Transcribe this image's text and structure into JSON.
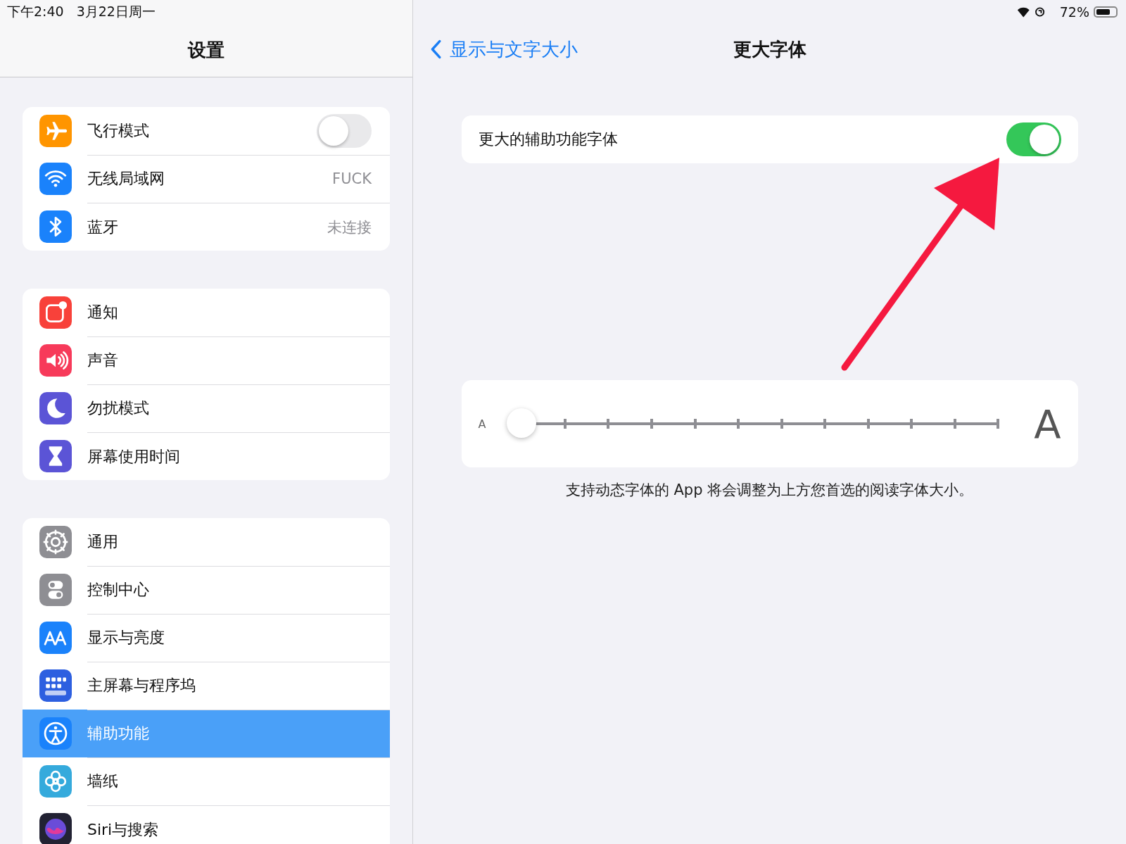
{
  "status_bar": {
    "time": "下午2:40",
    "date": "3月22日周一",
    "battery": "72%"
  },
  "sidebar": {
    "title": "设置",
    "groups": [
      [
        {
          "label": "飞行模式",
          "color": "#ff9500",
          "kind": "toggle",
          "on": false,
          "selected": false
        },
        {
          "label": "无线局域网",
          "color": "#1a82fb",
          "kind": "value",
          "value": "FUCK",
          "selected": false
        },
        {
          "label": "蓝牙",
          "color": "#1a82fb",
          "kind": "value",
          "value": "未连接",
          "selected": false
        }
      ],
      [
        {
          "label": "通知",
          "color": "#f8413a",
          "kind": "plain",
          "selected": false
        },
        {
          "label": "声音",
          "color": "#f73a5a",
          "kind": "plain",
          "selected": false
        },
        {
          "label": "勿扰模式",
          "color": "#5b54d6",
          "kind": "plain",
          "selected": false
        },
        {
          "label": "屏幕使用时间",
          "color": "#5b54d6",
          "kind": "plain",
          "selected": false
        }
      ],
      [
        {
          "label": "通用",
          "color": "#8e8e93",
          "kind": "plain",
          "selected": false
        },
        {
          "label": "控制中心",
          "color": "#8e8e93",
          "kind": "plain",
          "selected": false
        },
        {
          "label": "显示与亮度",
          "color": "#1a82fb",
          "kind": "plain",
          "selected": false
        },
        {
          "label": "主屏幕与程序坞",
          "color": "#2d5fe0",
          "kind": "plain",
          "selected": false
        },
        {
          "label": "辅助功能",
          "color": "#1a82fb",
          "kind": "plain",
          "selected": true
        },
        {
          "label": "墙纸",
          "color": "#35aadc",
          "kind": "plain",
          "selected": false
        },
        {
          "label": "Siri与搜索",
          "color": "#222233",
          "kind": "plain",
          "selected": false
        }
      ]
    ]
  },
  "detail": {
    "back": "显示与文字大小",
    "title": "更大字体",
    "toggle_row": {
      "label": "更大的辅助功能字体",
      "on": true
    },
    "slider": {
      "small_label": "A",
      "large_label": "A",
      "level": 0
    },
    "footer": "支持动态字体的 App 将会调整为上方您首选的阅读字体大小。"
  },
  "annotations": [
    {
      "kind": "arrow"
    }
  ]
}
